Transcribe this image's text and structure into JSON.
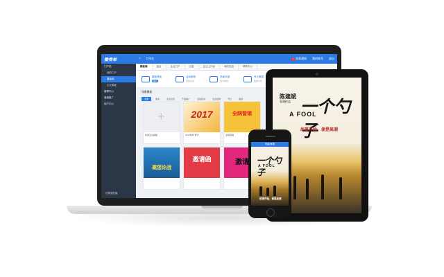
{
  "colors": {
    "accent": "#2c7be5",
    "sidebar": "#2b3646",
    "badge": "#e03a3a"
  },
  "laptop": {
    "topbar": {
      "logo": "微传单",
      "home_icon": "home-icon",
      "label": "工作台",
      "right_items": [
        "消息通知",
        "我的账号",
        "退出"
      ],
      "badge_count": "1"
    },
    "sidebar": {
      "items": [
        {
          "label": "门户站",
          "type": "group"
        },
        {
          "label": "我的门户",
          "type": "item"
        },
        {
          "label": "模板库",
          "type": "item",
          "active": true
        },
        {
          "label": "企业模板",
          "type": "item"
        },
        {
          "label": "管理中心",
          "type": "group"
        },
        {
          "label": "营销推广",
          "type": "group"
        },
        {
          "label": "用户中心",
          "type": "group"
        }
      ],
      "footer": "切换到旧版"
    },
    "tabs": [
      "模板库",
      "首页",
      "企业门户",
      "分类",
      "企业工作台",
      "我的作品",
      "帮助中心"
    ],
    "quick": [
      {
        "title": "模板样板",
        "sub": "免费",
        "pill": "推荐"
      },
      {
        "title": "活动推荐",
        "sub": "营销活动"
      },
      {
        "title": "场景关键",
        "sub": "场景推荐"
      },
      {
        "title": "专业数据",
        "sub": "数据分析"
      }
    ],
    "section_title": "场景模板",
    "filters": [
      "全部",
      "邀请",
      "企业宣传",
      "产品推广",
      "活动招商",
      "企业招聘",
      "节日",
      "其他"
    ],
    "cards": [
      {
        "caption": "新建空白模板",
        "thumb_text": ""
      },
      {
        "caption": "2017新年 贺卡",
        "thumb_text": "2017"
      },
      {
        "caption": "全网营销",
        "thumb_text": "全网营销"
      },
      {
        "caption": "全网营销 邀您论战",
        "thumb_text": "邀您论战"
      },
      {
        "caption": "邀请函",
        "thumb_text": "邀请函"
      },
      {
        "caption": "激请",
        "thumb_text": "激请"
      }
    ]
  },
  "ipad": {
    "name": "陈建斌",
    "name_sub": "导演作品",
    "big_title": "一个勺子",
    "fool": "A FOOL",
    "tagline": "故事开始，便是高潮"
  },
  "iphone": {
    "title_bar": "电影海报",
    "big_title": "一个勺子",
    "fool": "A FOOL",
    "footer": "故事开始，便是高潮"
  }
}
